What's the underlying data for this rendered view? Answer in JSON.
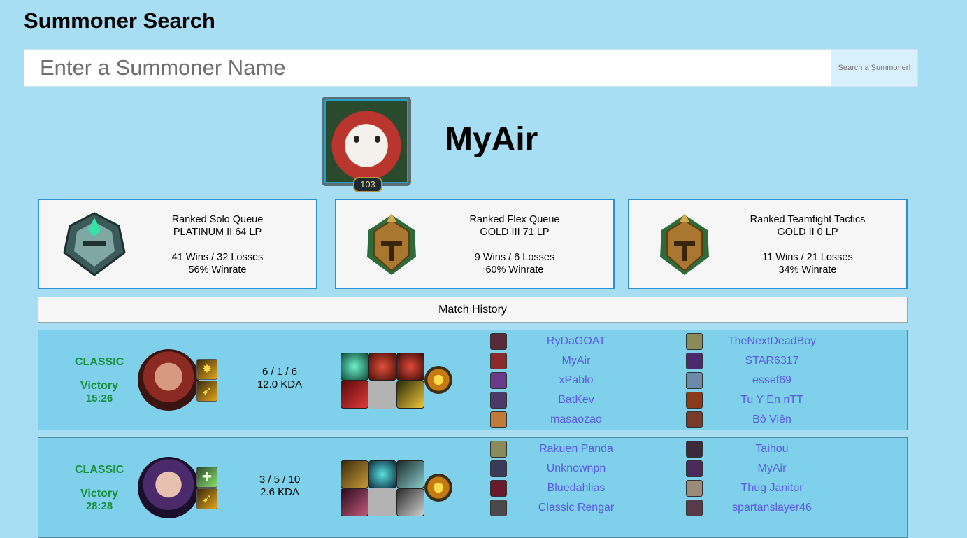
{
  "header": {
    "title": "Summoner Search"
  },
  "search": {
    "placeholder": "Enter a Summoner Name",
    "button_label": "Search a Summoner!"
  },
  "profile": {
    "summoner_name": "MyAir",
    "level": "103"
  },
  "ranks": [
    {
      "queue": "Ranked Solo Queue",
      "tier": "PLATINUM II 64 LP",
      "record": "41 Wins / 32 Losses",
      "winrate": "56% Winrate",
      "emblem": "platinum-emblem",
      "color": "#3a8a7a"
    },
    {
      "queue": "Ranked Flex Queue",
      "tier": "GOLD III 71 LP",
      "record": "9 Wins / 6 Losses",
      "winrate": "60% Winrate",
      "emblem": "gold-emblem",
      "color": "#b8863a"
    },
    {
      "queue": "Ranked Teamfight Tactics",
      "tier": "GOLD II 0 LP",
      "record": "11 Wins / 21 Losses",
      "winrate": "34% Winrate",
      "emblem": "gold-emblem",
      "color": "#b8863a"
    }
  ],
  "match_history": {
    "label": "Match History",
    "matches": [
      {
        "mode": "CLASSIC",
        "result": "Victory",
        "duration": "15:26",
        "kills_deaths_assists": "6 / 1 / 6",
        "kda": "12.0 KDA",
        "blue_team": [
          "RyDaGOAT",
          "MyAir",
          "xPablo",
          "BatKev",
          "masaozao"
        ],
        "red_team": [
          "TheNextDeadBoy",
          "STAR6317",
          "essef69",
          "Tu Y En nTT",
          "Bò Viên"
        ]
      },
      {
        "mode": "CLASSIC",
        "result": "Victory",
        "duration": "28:28",
        "kills_deaths_assists": "3 / 5 / 10",
        "kda": "2.6 KDA",
        "blue_team": [
          "Rakuen Panda",
          "Unknownpn",
          "Bluedahlias",
          "Classic Rengar"
        ],
        "red_team": [
          "Taihou",
          "MyAir",
          "Thug Janitor",
          "spartanslayer46"
        ]
      }
    ]
  },
  "colors": {
    "background": "#a8def4",
    "accent": "#2b8fd6",
    "victory": "#1a8f3e",
    "link": "#5a5ae0",
    "match_card": "#7fd0ea"
  }
}
